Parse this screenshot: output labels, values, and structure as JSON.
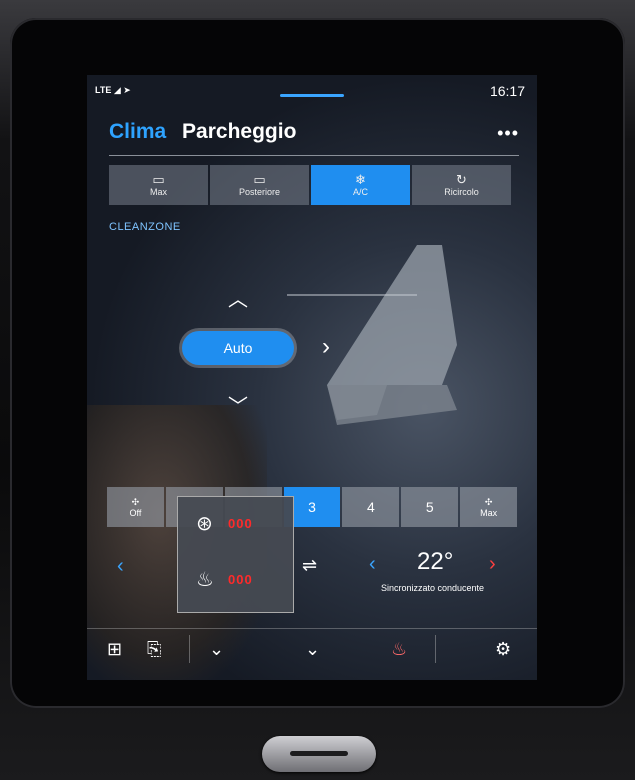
{
  "status": {
    "network": "LTE",
    "time": "16:17"
  },
  "tabs": {
    "clima": "Clima",
    "parcheggio": "Parcheggio",
    "more": "•••"
  },
  "airflow_buttons": [
    {
      "label": "Max",
      "icon": "defrost-front-icon",
      "active": false
    },
    {
      "label": "Posteriore",
      "icon": "defrost-rear-icon",
      "active": false
    },
    {
      "label": "A/C",
      "icon": "snowflake-icon",
      "active": true
    },
    {
      "label": "Ricircolo",
      "icon": "recirculation-icon",
      "active": false
    }
  ],
  "cleanzone": "CLEANZONE",
  "airflow_mode": "Auto",
  "fan": {
    "off_label": "Off",
    "max_label": "Max",
    "levels": [
      "3",
      "4",
      "5"
    ],
    "active_level": "3"
  },
  "heating_popup": {
    "steering_wheel_level": "000",
    "seat_level": "000",
    "active_color": "#ff2a2a"
  },
  "temperature": {
    "value": "22°",
    "sync_label": "Sincronizzato conducente"
  },
  "accent_color": "#1f8ef0"
}
